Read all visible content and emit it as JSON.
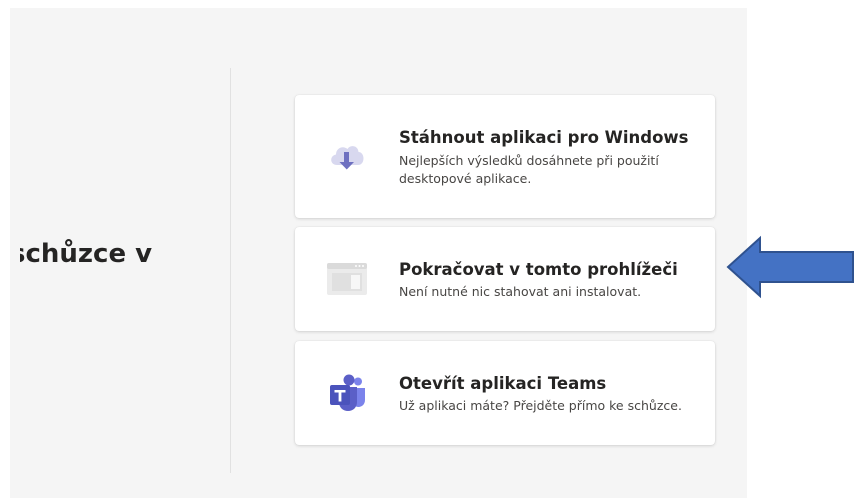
{
  "left": {
    "heading": "schůzce v"
  },
  "options": [
    {
      "title": "Stáhnout aplikaci pro Windows",
      "description": "Nejlepších výsledků dosáhnete při použití desktopové aplikace.",
      "icon": "cloud-download-icon"
    },
    {
      "title": "Pokračovat v tomto prohlížeči",
      "description": "Není nutné nic stahovat ani instalovat.",
      "icon": "browser-window-icon"
    },
    {
      "title": "Otevřít aplikaci Teams",
      "description": "Už aplikaci máte? Přejděte přímo ke schůzce.",
      "icon": "teams-logo-icon"
    }
  ],
  "annotation": {
    "arrow_color": "#4472C4",
    "arrow_border": "#2F528F"
  },
  "colors": {
    "panel_bg": "#f5f5f5",
    "card_bg": "#ffffff",
    "teams_purple": "#5b5fc7"
  }
}
